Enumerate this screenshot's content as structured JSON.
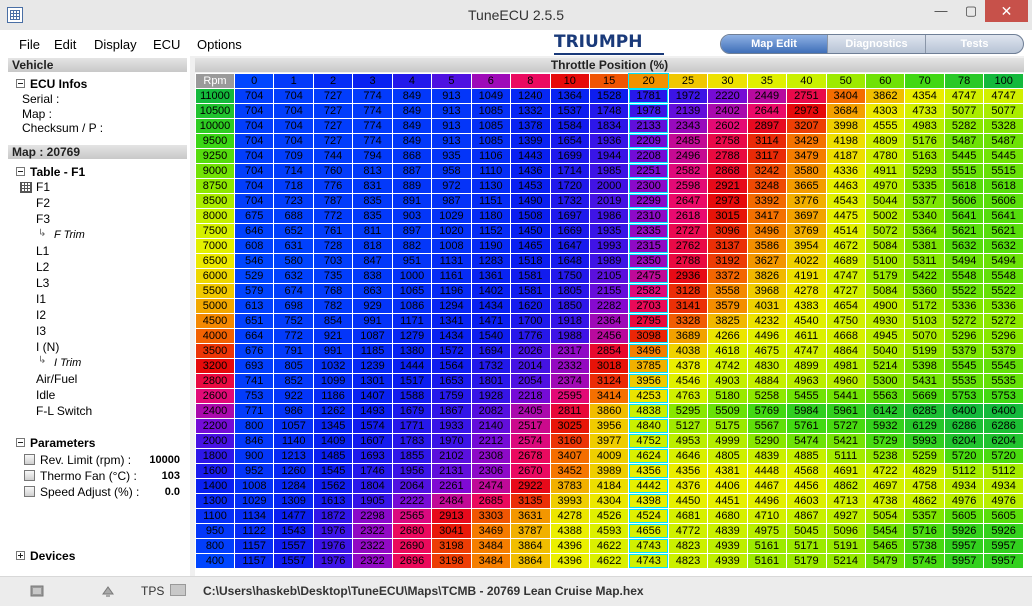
{
  "window": {
    "title": "TuneECU 2.5.5",
    "minimize": "—",
    "maximize": "▢",
    "close": "✕"
  },
  "menu": [
    "File",
    "Edit",
    "Display",
    "ECU",
    "Options"
  ],
  "brand": "TRIUMPH",
  "tabs": [
    "Map Edit",
    "Diagnostics",
    "Tests"
  ],
  "left": {
    "vehicle_header": "Vehicle",
    "ecu_infos": {
      "title": "ECU Infos",
      "serial": "Serial :",
      "map": "Map :",
      "checksum": "Checksum / P :"
    },
    "map_header": "Map : 20769",
    "table_header": "Table - F1",
    "table_items": [
      "F1",
      "F2",
      "F3",
      "F Trim",
      "L1",
      "L2",
      "L3",
      "I1",
      "I2",
      "I3",
      "I (N)",
      "I Trim",
      "Air/Fuel",
      "Idle",
      "F-L Switch"
    ],
    "parameters": {
      "title": "Parameters",
      "items": [
        {
          "label": "Rev. Limit (rpm) :",
          "value": "10000"
        },
        {
          "label": "Thermo Fan (°C) :",
          "value": "103"
        },
        {
          "label": "Speed Adjust (%) :",
          "value": "0.0"
        }
      ]
    },
    "devices": "Devices"
  },
  "grid": {
    "title": "Throttle Position (%)",
    "corner": "Rpm",
    "columns": [
      "0",
      "1",
      "2",
      "3",
      "4",
      "5",
      "6",
      "8",
      "10",
      "15",
      "20",
      "25",
      "30",
      "35",
      "40",
      "50",
      "60",
      "70",
      "78",
      "100"
    ],
    "rows": [
      {
        "rpm": "11000",
        "values": [
          704,
          704,
          727,
          774,
          849,
          913,
          1049,
          1240,
          1364,
          1528,
          1781,
          1972,
          2220,
          2449,
          2751,
          3404,
          3862,
          4354,
          4747,
          4747
        ]
      },
      {
        "rpm": "10500",
        "values": [
          704,
          704,
          727,
          774,
          849,
          913,
          1085,
          1332,
          1537,
          1748,
          1978,
          2139,
          2402,
          2644,
          2973,
          3684,
          4303,
          4733,
          5077,
          5077
        ]
      },
      {
        "rpm": "10000",
        "values": [
          704,
          704,
          727,
          774,
          849,
          913,
          1085,
          1378,
          1584,
          1834,
          2133,
          2343,
          2602,
          2897,
          3207,
          3998,
          4555,
          4983,
          5282,
          5328
        ]
      },
      {
        "rpm": "9500",
        "values": [
          704,
          704,
          727,
          774,
          849,
          913,
          1085,
          1399,
          1654,
          1936,
          2209,
          2485,
          2758,
          3114,
          3429,
          4198,
          4809,
          5176,
          5487,
          5487
        ]
      },
      {
        "rpm": "9250",
        "values": [
          704,
          709,
          744,
          794,
          868,
          935,
          1106,
          1443,
          1699,
          1944,
          2208,
          2496,
          2788,
          3117,
          3479,
          4187,
          4780,
          5163,
          5445,
          5445
        ]
      },
      {
        "rpm": "9000",
        "values": [
          704,
          714,
          760,
          813,
          887,
          958,
          1110,
          1436,
          1714,
          1985,
          2251,
          2582,
          2868,
          3242,
          3580,
          4336,
          4911,
          5293,
          5515,
          5515
        ]
      },
      {
        "rpm": "8750",
        "values": [
          704,
          718,
          776,
          831,
          889,
          972,
          1130,
          1453,
          1720,
          2000,
          2300,
          2598,
          2921,
          3248,
          3665,
          4463,
          4970,
          5335,
          5618,
          5618
        ]
      },
      {
        "rpm": "8500",
        "values": [
          704,
          723,
          787,
          835,
          891,
          987,
          1151,
          1490,
          1732,
          2019,
          2299,
          2647,
          2973,
          3392,
          3776,
          4543,
          5044,
          5377,
          5606,
          5606
        ]
      },
      {
        "rpm": "8000",
        "values": [
          675,
          688,
          772,
          835,
          903,
          1029,
          1180,
          1508,
          1697,
          1986,
          2310,
          2618,
          3015,
          3417,
          3697,
          4475,
          5002,
          5340,
          5641,
          5641
        ]
      },
      {
        "rpm": "7500",
        "values": [
          646,
          652,
          761,
          811,
          897,
          1020,
          1152,
          1450,
          1669,
          1935,
          2335,
          2727,
          3096,
          3496,
          3769,
          4514,
          5072,
          5364,
          5621,
          5621
        ]
      },
      {
        "rpm": "7000",
        "values": [
          608,
          631,
          728,
          818,
          882,
          1008,
          1190,
          1465,
          1647,
          1993,
          2315,
          2762,
          3137,
          3586,
          3954,
          4672,
          5084,
          5381,
          5632,
          5632
        ]
      },
      {
        "rpm": "6500",
        "values": [
          546,
          580,
          703,
          847,
          951,
          1131,
          1283,
          1518,
          1648,
          1989,
          2350,
          2788,
          3192,
          3627,
          4022,
          4689,
          5100,
          5311,
          5494,
          5494
        ]
      },
      {
        "rpm": "6000",
        "values": [
          529,
          632,
          735,
          838,
          1000,
          1161,
          1361,
          1581,
          1750,
          2105,
          2475,
          2936,
          3372,
          3826,
          4191,
          4747,
          5179,
          5422,
          5548,
          5548
        ]
      },
      {
        "rpm": "5500",
        "values": [
          579,
          674,
          768,
          863,
          1065,
          1196,
          1402,
          1581,
          1805,
          2155,
          2582,
          3128,
          3558,
          3968,
          4278,
          4727,
          5084,
          5360,
          5522,
          5522
        ]
      },
      {
        "rpm": "5000",
        "values": [
          613,
          698,
          782,
          929,
          1086,
          1294,
          1434,
          1620,
          1850,
          2282,
          2703,
          3141,
          3579,
          4031,
          4383,
          4654,
          4900,
          5172,
          5336,
          5336
        ]
      },
      {
        "rpm": "4500",
        "values": [
          651,
          752,
          854,
          991,
          1171,
          1341,
          1471,
          1700,
          1918,
          2364,
          2795,
          3328,
          3825,
          4232,
          4540,
          4750,
          4930,
          5103,
          5272,
          5272
        ]
      },
      {
        "rpm": "4000",
        "values": [
          664,
          772,
          921,
          1087,
          1279,
          1434,
          1540,
          1776,
          1988,
          2456,
          3098,
          3689,
          4266,
          4496,
          4611,
          4668,
          4945,
          5070,
          5296,
          5296
        ]
      },
      {
        "rpm": "3500",
        "values": [
          676,
          791,
          991,
          1185,
          1380,
          1572,
          1694,
          2026,
          2317,
          2854,
          3496,
          4038,
          4618,
          4675,
          4747,
          4864,
          5040,
          5199,
          5379,
          5379
        ]
      },
      {
        "rpm": "3200",
        "values": [
          693,
          805,
          1032,
          1239,
          1444,
          1564,
          1732,
          2014,
          2332,
          3018,
          3785,
          4378,
          4742,
          4830,
          4899,
          4981,
          5214,
          5398,
          5545,
          5545
        ]
      },
      {
        "rpm": "2800",
        "values": [
          741,
          852,
          1099,
          1301,
          1517,
          1653,
          1801,
          2054,
          2374,
          3124,
          3956,
          4546,
          4903,
          4884,
          4963,
          4960,
          5300,
          5431,
          5535,
          5535
        ]
      },
      {
        "rpm": "2600",
        "values": [
          753,
          922,
          1186,
          1407,
          1588,
          1759,
          1928,
          2218,
          2595,
          3414,
          4253,
          4763,
          5180,
          5258,
          5455,
          5441,
          5563,
          5669,
          5753,
          5753
        ]
      },
      {
        "rpm": "2400",
        "values": [
          771,
          986,
          1262,
          1493,
          1679,
          1867,
          2082,
          2405,
          2811,
          3860,
          4838,
          5295,
          5509,
          5769,
          5984,
          5961,
          6142,
          6285,
          6400,
          6400
        ]
      },
      {
        "rpm": "2200",
        "values": [
          800,
          1057,
          1345,
          1574,
          1771,
          1933,
          2140,
          2517,
          3025,
          3956,
          4840,
          5127,
          5175,
          5567,
          5761,
          5727,
          5932,
          6129,
          6286,
          6286
        ]
      },
      {
        "rpm": "2000",
        "values": [
          846,
          1140,
          1409,
          1607,
          1783,
          1970,
          2212,
          2574,
          3160,
          3977,
          4752,
          4953,
          4999,
          5290,
          5474,
          5421,
          5729,
          5993,
          6204,
          6204
        ]
      },
      {
        "rpm": "1800",
        "values": [
          900,
          1213,
          1485,
          1693,
          1855,
          2102,
          2308,
          2678,
          3407,
          4009,
          4624,
          4646,
          4805,
          4839,
          4885,
          5111,
          5238,
          5259,
          5720,
          5720
        ]
      },
      {
        "rpm": "1600",
        "values": [
          952,
          1260,
          1545,
          1746,
          1956,
          2131,
          2306,
          2670,
          3452,
          3989,
          4356,
          4356,
          4381,
          4448,
          4568,
          4691,
          4722,
          4829,
          5112,
          5112
        ]
      },
      {
        "rpm": "1400",
        "values": [
          1008,
          1284,
          1562,
          1804,
          2064,
          2261,
          2474,
          2922,
          3783,
          4184,
          4442,
          4376,
          4406,
          4467,
          4456,
          4862,
          4697,
          4758,
          4934,
          4934
        ]
      },
      {
        "rpm": "1300",
        "values": [
          1029,
          1309,
          1613,
          1905,
          2222,
          2484,
          2685,
          3135,
          3993,
          4304,
          4398,
          4450,
          4451,
          4496,
          4603,
          4713,
          4738,
          4862,
          4976,
          4976
        ]
      },
      {
        "rpm": "1100",
        "values": [
          1134,
          1477,
          1872,
          2298,
          2565,
          2913,
          3303,
          3631,
          4278,
          4526,
          4524,
          4681,
          4680,
          4710,
          4867,
          4927,
          5054,
          5357,
          5605,
          5605
        ]
      },
      {
        "rpm": "950",
        "values": [
          1122,
          1543,
          1976,
          2322,
          2680,
          3041,
          3469,
          3787,
          4388,
          4593,
          4656,
          4772,
          4839,
          4975,
          5045,
          5096,
          5454,
          5716,
          5926,
          5926
        ]
      },
      {
        "rpm": "800",
        "values": [
          1157,
          1557,
          1976,
          2322,
          2690,
          3198,
          3484,
          3864,
          4396,
          4622,
          4743,
          4823,
          4939,
          5161,
          5171,
          5191,
          5465,
          5738,
          5957,
          5957
        ]
      },
      {
        "rpm": "400",
        "values": [
          1157,
          1557,
          1976,
          2322,
          2696,
          3198,
          3484,
          3864,
          4396,
          4622,
          4743,
          4823,
          4939,
          5161,
          5179,
          5214,
          5479,
          5745,
          5957,
          5957
        ]
      }
    ]
  },
  "status": {
    "tps_label": "TPS",
    "file_path": "C:\\Users\\haskeb\\Desktop\\TuneECU\\Maps\\TCMB - 20769 Lean Cruise Map.hex"
  },
  "colors": {
    "accent": "#3f6fb8",
    "close": "#c7514a",
    "highlight": "#00e5ff"
  }
}
